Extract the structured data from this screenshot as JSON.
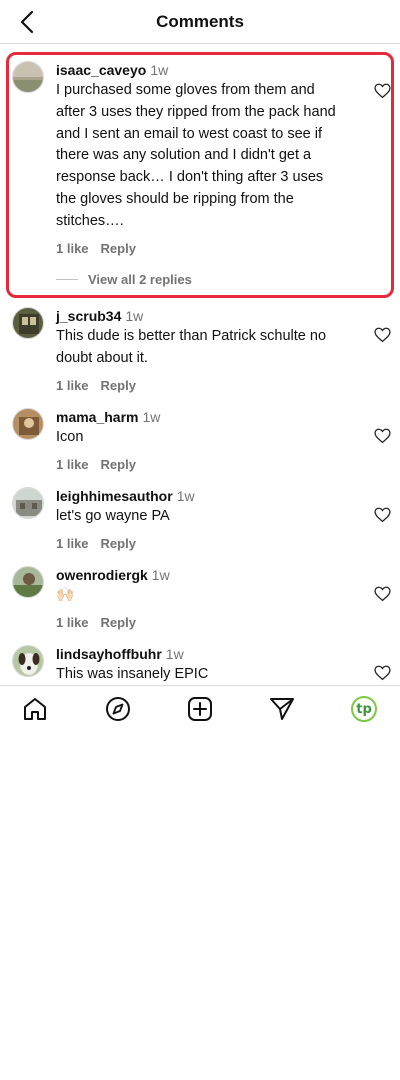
{
  "header": {
    "title": "Comments"
  },
  "comments": [
    {
      "username": "isaac_caveyo",
      "time": "1w",
      "text": "I purchased some gloves from them and after 3 uses they ripped from the pack hand and I sent an email to west coast to see if there was any solution and I didn't get a response back… I don't thing after 3 uses the gloves should be ripping from the stitches….",
      "likes": "1 like",
      "reply": "Reply",
      "view_replies": "View all 2 replies"
    },
    {
      "username": "j_scrub34",
      "time": "1w",
      "text": "This dude is better than Patrick schulte no doubt about it.",
      "likes": "1 like",
      "reply": "Reply"
    },
    {
      "username": "mama_harm",
      "time": "1w",
      "text": "Icon",
      "likes": "1 like",
      "reply": "Reply"
    },
    {
      "username": "leighhimesauthor",
      "time": "1w",
      "text": "let's go wayne PA",
      "likes": "1 like",
      "reply": "Reply"
    },
    {
      "username": "owenrodiergk",
      "time": "1w",
      "text": "🙌🏻",
      "likes": "1 like",
      "reply": "Reply"
    },
    {
      "username": "lindsayhoffbuhr",
      "time": "1w",
      "text": "This was insanely EPIC",
      "likes": "",
      "reply": ""
    }
  ],
  "tabbar": {
    "items": [
      "home-icon",
      "explore-icon",
      "create-icon",
      "send-icon",
      "profile-avatar"
    ],
    "profile_initials": "tp"
  },
  "colors": {
    "highlight": "#e8283b",
    "secondary_text": "#737373",
    "profile_ring": "#7ac943"
  }
}
